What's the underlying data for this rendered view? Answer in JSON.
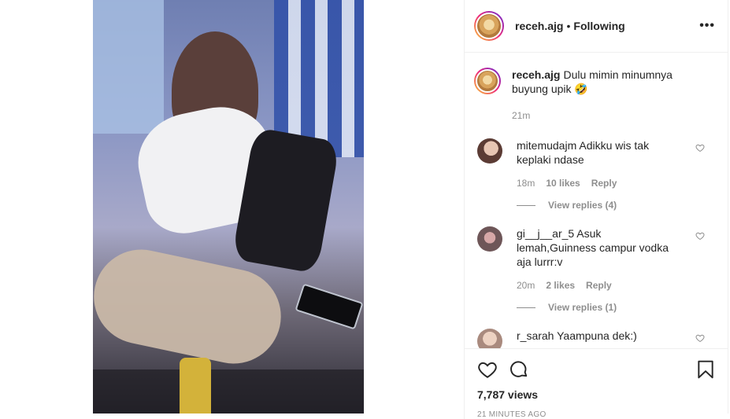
{
  "post": {
    "username": "receh.ajg",
    "separator": "•",
    "follow_status": "Following",
    "more_label": "•••"
  },
  "caption": {
    "username": "receh.ajg",
    "text": "Dulu mimin minumnya buyung upik 🤣",
    "time": "21m"
  },
  "comments": [
    {
      "username": "mitemudajm",
      "text": "Adikku wis tak keplaki ndase",
      "time": "18m",
      "likes": "10 likes",
      "reply_label": "Reply",
      "view_replies": "View replies (4)"
    },
    {
      "username": "gi__j__ar_5",
      "text": "Asuk lemah,Guinness campur vodka aja lurrr:v",
      "time": "20m",
      "likes": "2 likes",
      "reply_label": "Reply",
      "view_replies": "View replies (1)"
    },
    {
      "username": "r_sarah",
      "text": "Yaampuna dek:)"
    }
  ],
  "footer": {
    "views": "7,787 views",
    "posted_ago": "21 MINUTES AGO"
  },
  "icons": {
    "like": "heart-icon",
    "comment": "comment-icon",
    "save": "bookmark-icon",
    "more": "more-icon"
  }
}
